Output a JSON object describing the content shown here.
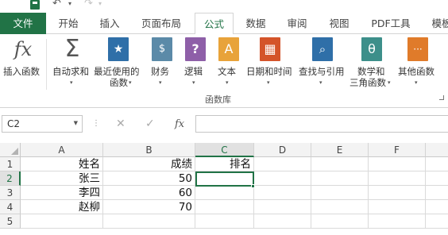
{
  "quick_access": {
    "save_icon": "save-icon",
    "undo_icon": "undo-icon",
    "redo_icon": "redo-icon"
  },
  "tabs": [
    "文件",
    "开始",
    "插入",
    "页面布局",
    "公式",
    "数据",
    "审阅",
    "视图",
    "PDF工具",
    "模板"
  ],
  "active_tab": "公式",
  "ribbon": {
    "buttons": [
      {
        "label": "插入函数",
        "icon": "insert-function-icon",
        "glyph": "fx"
      },
      {
        "label": "自动求和",
        "icon": "autosum-icon",
        "glyph": "Σ"
      },
      {
        "label": "最近使用的",
        "label2": "函数",
        "icon": "recent-functions-icon",
        "glyph": "★"
      },
      {
        "label": "财务",
        "icon": "financial-icon",
        "glyph": "$"
      },
      {
        "label": "逻辑",
        "icon": "logical-icon",
        "glyph": "?"
      },
      {
        "label": "文本",
        "icon": "text-icon",
        "glyph": "A"
      },
      {
        "label": "日期和时间",
        "icon": "date-time-icon",
        "glyph": "▦"
      },
      {
        "label": "查找与引用",
        "icon": "lookup-reference-icon",
        "glyph": "⌕"
      },
      {
        "label": "数学和",
        "label2": "三角函数",
        "icon": "math-trig-icon",
        "glyph": "θ"
      },
      {
        "label": "其他函数",
        "icon": "more-functions-icon",
        "glyph": "···"
      }
    ],
    "group_label": "函数库"
  },
  "formula_bar": {
    "name_box": "C2",
    "cancel_glyph": "✕",
    "enter_glyph": "✓",
    "fx_glyph": "fx",
    "formula": ""
  },
  "sheet": {
    "columns": [
      "A",
      "B",
      "C",
      "D",
      "E",
      "F"
    ],
    "rows": [
      "1",
      "2",
      "3",
      "4",
      "5"
    ],
    "selected_cell": "C2",
    "cells": {
      "A1": "姓名",
      "B1": "成绩",
      "C1": "排名",
      "A2": "张三",
      "B2": "50",
      "A3": "李四",
      "B3": "60",
      "A4": "赵柳",
      "B4": "70"
    }
  },
  "colors": {
    "accent": "#217346",
    "icon_blue": "#2f6fa8",
    "icon_purple": "#8e5fa8",
    "icon_orange": "#e8a33a",
    "icon_red": "#d4542a",
    "icon_teal": "#3d8f8a",
    "icon_gray": "#6b8fa8"
  }
}
